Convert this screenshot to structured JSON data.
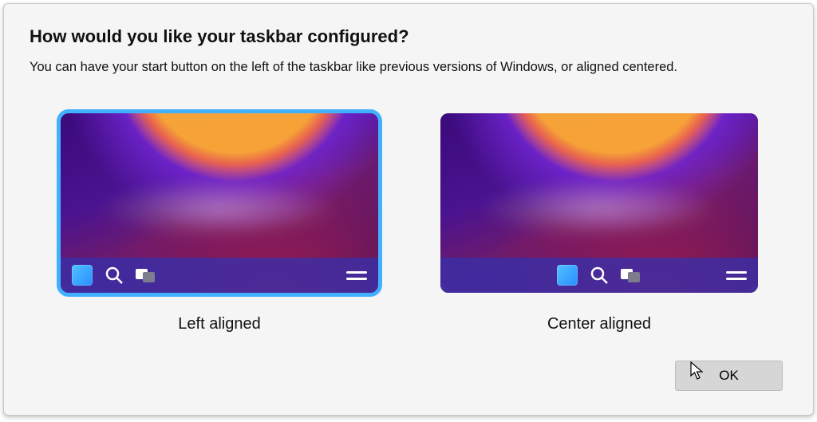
{
  "dialog": {
    "title": "How would you like your taskbar configured?",
    "subtitle": "You can have your start button on the left of the taskbar like previous versions of Windows, or aligned centered."
  },
  "options": {
    "left": {
      "label": "Left aligned",
      "selected": true
    },
    "center": {
      "label": "Center aligned",
      "selected": false
    }
  },
  "footer": {
    "ok_label": "OK"
  },
  "icons": {
    "start": "start-tile-icon",
    "search": "search-icon",
    "taskview": "taskview-icon",
    "tray": "tray-lines-icon"
  },
  "colors": {
    "selection_outline": "#41b1ff",
    "taskbar_tint": "rgba(55,48,170,0.78)"
  }
}
